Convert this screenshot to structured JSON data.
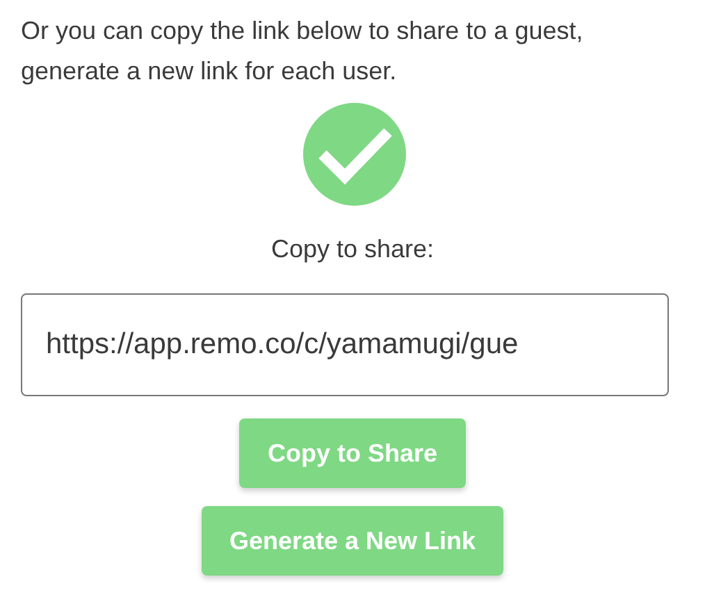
{
  "intro": "Or you can copy the link below to share to a guest, generate a new link for each user.",
  "success": true,
  "copy_label": "Copy to share:",
  "link_field": {
    "value": "https://app.remo.co/c/yamamugi/gue"
  },
  "buttons": [
    "Copy to Share",
    "Generate a New Link"
  ]
}
